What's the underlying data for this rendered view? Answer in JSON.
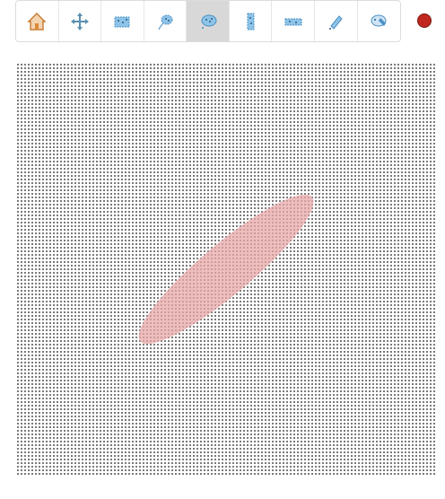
{
  "toolbar": {
    "tools": [
      {
        "icon": "home-icon",
        "state": "normal"
      },
      {
        "icon": "pan-icon",
        "state": "normal"
      },
      {
        "icon": "box-select-icon",
        "state": "normal"
      },
      {
        "icon": "lasso-select-icon",
        "state": "normal"
      },
      {
        "icon": "poly-select-icon",
        "state": "active"
      },
      {
        "icon": "x-range-select-icon",
        "state": "normal"
      },
      {
        "icon": "y-range-select-icon",
        "state": "normal"
      },
      {
        "icon": "point-select-icon",
        "state": "normal"
      },
      {
        "icon": "edit-icon",
        "state": "normal"
      }
    ]
  },
  "status": {
    "color": "#c0281f",
    "border": "#7a1a14"
  },
  "colors": {
    "grid_dot": "#7a7a7a",
    "selection_fill": "#e8a8a8",
    "tool_blue": "#4a90c4",
    "home_roof": "#d98b3a",
    "active_bg": "#d8d8d8"
  }
}
